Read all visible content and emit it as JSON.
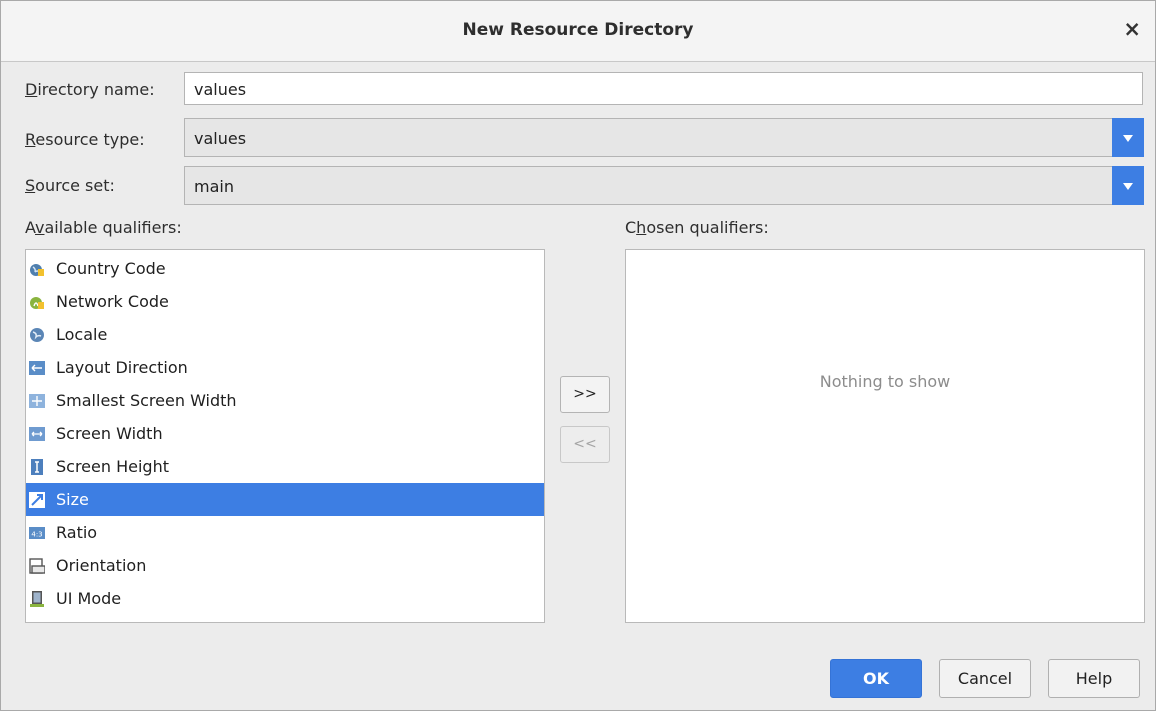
{
  "dialog": {
    "title": "New Resource Directory",
    "close_glyph": "×"
  },
  "fields": {
    "directory_name": {
      "label_mnemonic": "D",
      "label_rest": "irectory name:",
      "value": "values"
    },
    "resource_type": {
      "label_mnemonic": "R",
      "label_rest": "esource type:",
      "value": "values"
    },
    "source_set": {
      "label_mnemonic": "S",
      "label_rest": "ource set:",
      "value": "main"
    }
  },
  "available": {
    "label_pre": "A",
    "label_mnemonic": "v",
    "label_rest": "ailable qualifiers:",
    "items": [
      {
        "label": "Country Code",
        "icon": "country-code-icon"
      },
      {
        "label": "Network Code",
        "icon": "network-code-icon"
      },
      {
        "label": "Locale",
        "icon": "globe-icon"
      },
      {
        "label": "Layout Direction",
        "icon": "layout-direction-icon"
      },
      {
        "label": "Smallest Screen Width",
        "icon": "smallest-width-icon"
      },
      {
        "label": "Screen Width",
        "icon": "screen-width-icon"
      },
      {
        "label": "Screen Height",
        "icon": "screen-height-icon"
      },
      {
        "label": "Size",
        "icon": "size-icon",
        "selected": true
      },
      {
        "label": "Ratio",
        "icon": "ratio-icon"
      },
      {
        "label": "Orientation",
        "icon": "orientation-icon"
      },
      {
        "label": "UI Mode",
        "icon": "ui-mode-icon"
      }
    ]
  },
  "chosen": {
    "label_pre": "C",
    "label_mnemonic": "h",
    "label_rest": "osen qualifiers:",
    "empty_text": "Nothing to show"
  },
  "transfer": {
    "add_label": ">>",
    "remove_label": "<<"
  },
  "buttons": {
    "ok": "OK",
    "cancel": "Cancel",
    "help": "Help"
  },
  "colors": {
    "accent": "#3d7ee3",
    "background": "#ececec"
  }
}
